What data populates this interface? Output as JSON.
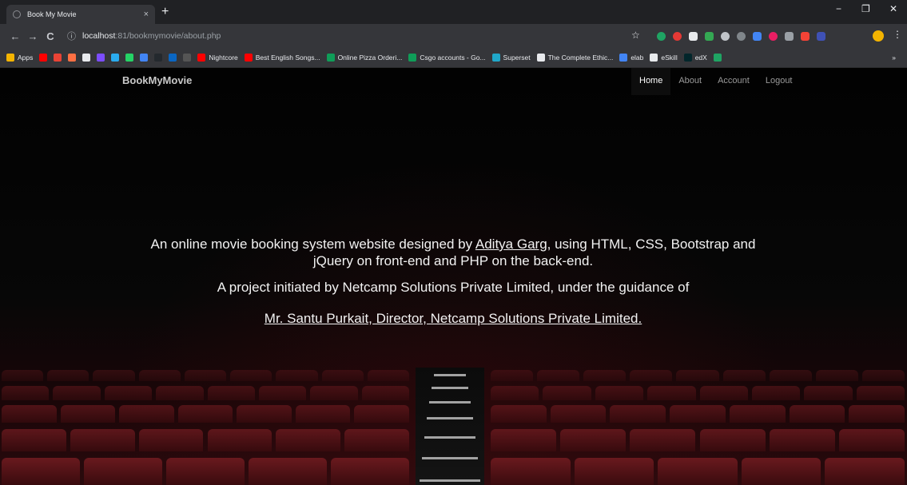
{
  "browser": {
    "tab_title": "Book My Movie",
    "tab_close": "×",
    "new_tab": "+",
    "win_min": "−",
    "win_max": "❐",
    "win_close": "✕",
    "nav_back": "←",
    "nav_forward": "→",
    "nav_reload": "C",
    "url_host": "localhost",
    "url_path": ":81/bookmymovie/about.php",
    "star": "☆",
    "menu": "⋮"
  },
  "bookmarks": [
    {
      "label": "Apps",
      "color": "#f4b400"
    },
    {
      "label": "",
      "color": "#ff0000"
    },
    {
      "label": "",
      "color": "#ea4335"
    },
    {
      "label": "",
      "color": "#ff7043"
    },
    {
      "label": "",
      "color": "#e8eaed"
    },
    {
      "label": "",
      "color": "#7c4dff"
    },
    {
      "label": "",
      "color": "#2aabee"
    },
    {
      "label": "",
      "color": "#25d366"
    },
    {
      "label": "",
      "color": "#4285f4"
    },
    {
      "label": "",
      "color": "#24292e"
    },
    {
      "label": "",
      "color": "#0a66c2"
    },
    {
      "label": "",
      "color": "#555555"
    },
    {
      "label": "Nightcore",
      "color": "#ff0000"
    },
    {
      "label": "Best English Songs...",
      "color": "#ff0000"
    },
    {
      "label": "Online Pizza Orderi...",
      "color": "#0f9d58"
    },
    {
      "label": "Csgo accounts - Go...",
      "color": "#0f9d58"
    },
    {
      "label": "Superset",
      "color": "#20a7c9"
    },
    {
      "label": "The Complete Ethic...",
      "color": "#e8eaed"
    },
    {
      "label": "elab",
      "color": "#4285f4"
    },
    {
      "label": "eSkill",
      "color": "#e8eaed"
    },
    {
      "label": "edX",
      "color": "#02262b"
    },
    {
      "label": "",
      "color": "#1fa463"
    }
  ],
  "bookmarks_overflow": "»",
  "site": {
    "brand": "BookMyMovie",
    "nav": [
      "Home",
      "About",
      "Account",
      "Logout"
    ],
    "active_nav": "Home",
    "content": {
      "line1_before": "An online movie booking system website designed by ",
      "line1_link": "Aditya Garg",
      "line1_after": ", using HTML, CSS, Bootstrap and jQuery on front-end and PHP on the back-end.",
      "line2": "A project initiated by Netcamp Solutions Private Limited, under the guidance of",
      "director_link": "Mr. Santu Purkait, Director, Netcamp Solutions Private Limited."
    }
  }
}
